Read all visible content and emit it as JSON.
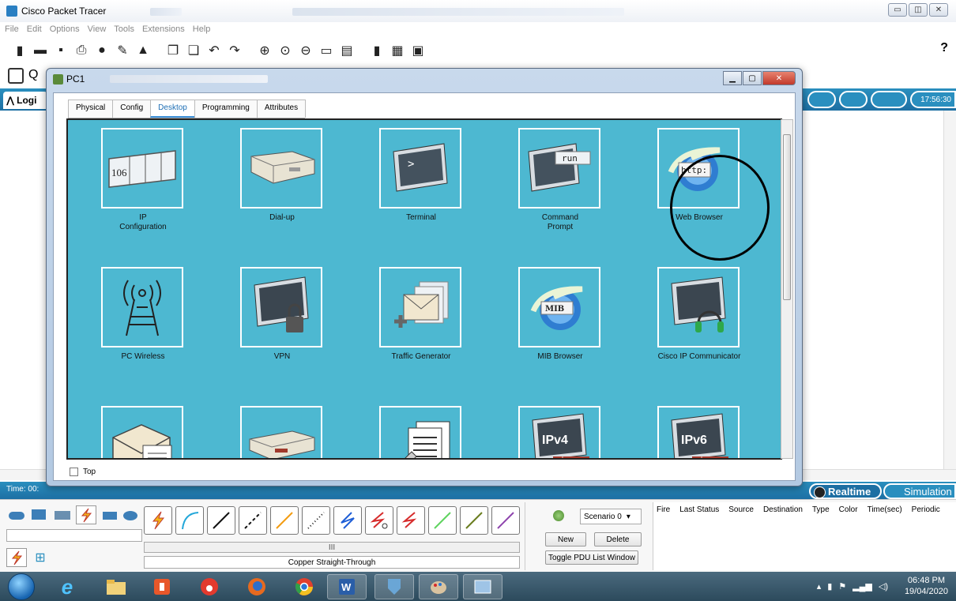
{
  "app": {
    "title": "Cisco Packet Tracer",
    "menu": [
      "File",
      "Edit",
      "Options",
      "View",
      "Tools",
      "Extensions",
      "Help"
    ],
    "help_label": "?",
    "logical_tab": "Logi",
    "clock": "17:56:30"
  },
  "pc1": {
    "title": "PC1",
    "tabs": [
      "Physical",
      "Config",
      "Desktop",
      "Programming",
      "Attributes"
    ],
    "active_tab": "Desktop",
    "top_checkbox_label": "Top",
    "apps": [
      {
        "label": "IP\nConfiguration",
        "icon": "ip-configuration-icon"
      },
      {
        "label": "Dial-up",
        "icon": "dial-up-icon"
      },
      {
        "label": "Terminal",
        "icon": "terminal-icon"
      },
      {
        "label": "Command\nPrompt",
        "icon": "command-prompt-icon"
      },
      {
        "label": "Web Browser",
        "icon": "web-browser-icon"
      },
      {
        "label": "PC Wireless",
        "icon": "pc-wireless-icon"
      },
      {
        "label": "VPN",
        "icon": "vpn-icon"
      },
      {
        "label": "Traffic Generator",
        "icon": "traffic-generator-icon"
      },
      {
        "label": "MIB Browser",
        "icon": "mib-browser-icon"
      },
      {
        "label": "Cisco IP Communicator",
        "icon": "cisco-ip-communicator-icon"
      },
      {
        "label": "",
        "icon": "email-icon"
      },
      {
        "label": "",
        "icon": "pppoe-dialer-icon"
      },
      {
        "label": "",
        "icon": "text-editor-icon"
      },
      {
        "label": "",
        "icon": "ipv4-firewall-icon"
      },
      {
        "label": "",
        "icon": "ipv6-firewall-icon"
      }
    ],
    "icon_text": {
      "ip_number": "106",
      "run": "run",
      "http": "http:",
      "mib": "MIB",
      "ipv4": "IPv4",
      "ipv6": "IPv6"
    }
  },
  "bottom": {
    "time_label": "Time: 00:",
    "realtime": "Realtime",
    "simulation": "Simulation",
    "cable_name": "Copper Straight-Through",
    "scenario": "Scenario 0",
    "new_label": "New",
    "delete_label": "Delete",
    "toggle_label": "Toggle PDU List Window",
    "pdu_columns": [
      "Fire",
      "Last Status",
      "Source",
      "Destination",
      "Type",
      "Color",
      "Time(sec)",
      "Periodic"
    ],
    "scroll_mark": "III"
  },
  "taskbar": {
    "time": "06:48 PM",
    "date": "19/04/2020"
  },
  "colors": {
    "desktop_bg": "#4db8d1",
    "pt_blue": "#2a8fbf",
    "annotation_circle": "#000000"
  }
}
